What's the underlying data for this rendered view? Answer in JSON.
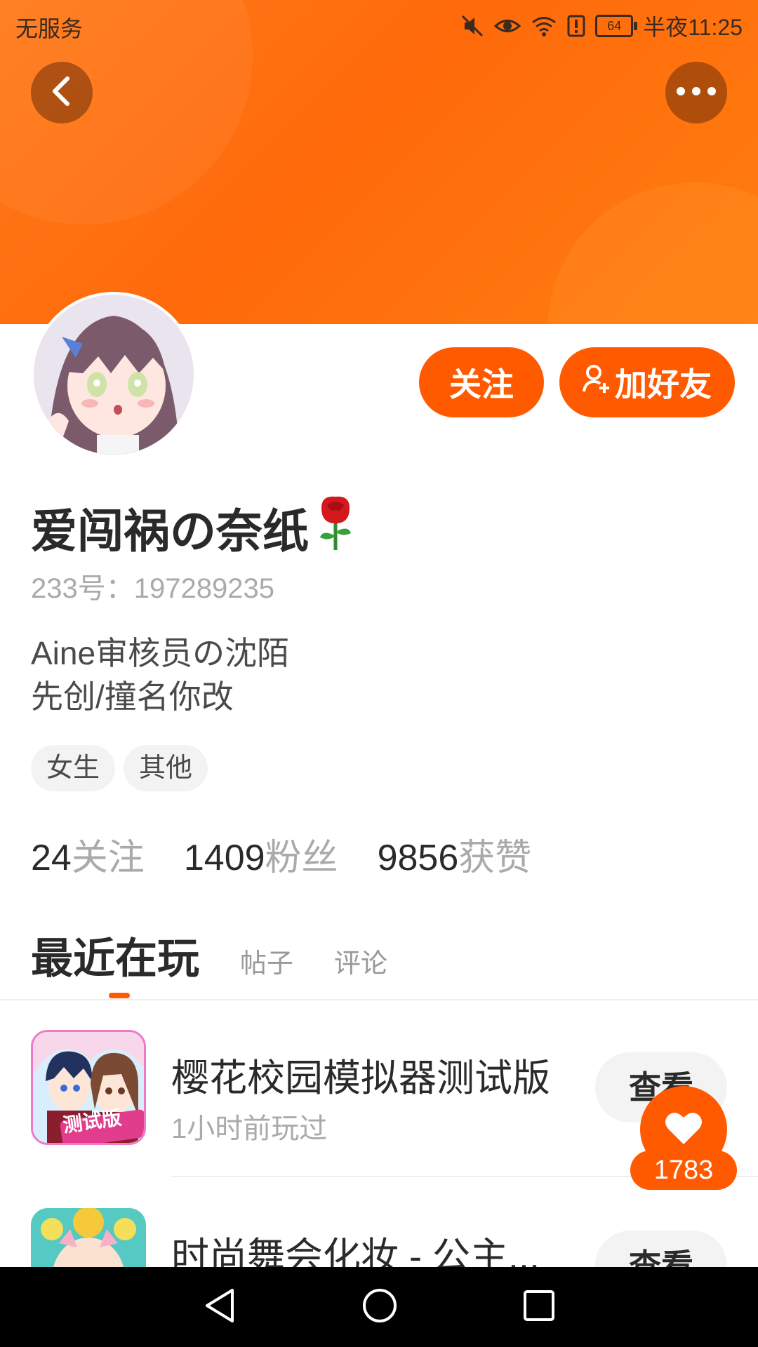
{
  "status_bar": {
    "carrier": "无服务",
    "battery": "64",
    "time": "半夜11:25"
  },
  "icons": {
    "back": "chevron-left-icon",
    "more": "more-dots-icon",
    "mute": "mute-icon",
    "eye": "eye-icon",
    "wifi": "wifi-icon",
    "alert": "alert-icon",
    "add_friend": "add-user-icon",
    "rose": "rose-emoji",
    "heart": "heart-icon",
    "nav_back": "triangle-back-icon",
    "nav_home": "circle-home-icon",
    "nav_recent": "square-recent-icon"
  },
  "colors": {
    "accent": "#ff5a00",
    "header": "#ff7a1a"
  },
  "profile": {
    "follow_label": "关注",
    "add_friend_label": "加好友",
    "nickname": "爱闯祸の奈纸",
    "uid": "233号：197289235",
    "bio_line1": "Aine审核员の沈陌",
    "bio_line2": "先创/撞名你改",
    "tags": [
      "女生",
      "其他"
    ],
    "stats": [
      {
        "num": "24",
        "label": "关注"
      },
      {
        "num": "1409",
        "label": "粉丝"
      },
      {
        "num": "9856",
        "label": "获赞"
      }
    ]
  },
  "tabs": {
    "active": "最近在玩",
    "items": [
      "帖子",
      "评论"
    ]
  },
  "games": [
    {
      "title": "樱花校园模拟器测试版",
      "subtitle": "1小时前玩过",
      "button": "查看",
      "icon_badge": "测试版"
    },
    {
      "title": "时尚舞会化妆 - 公主...",
      "button": "查看"
    }
  ],
  "like": {
    "count": "1783"
  }
}
